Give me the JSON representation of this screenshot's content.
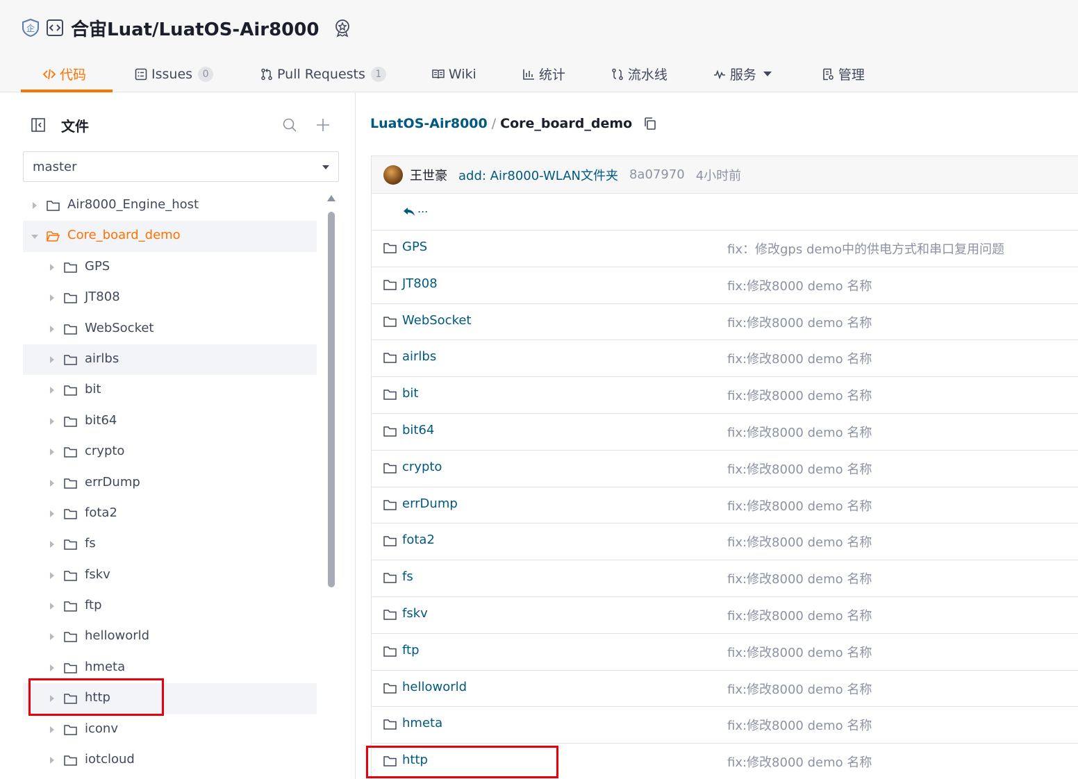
{
  "header": {
    "repo_title": "合宙Luat/LuatOS-Air8000",
    "tabs": [
      {
        "label": "代码",
        "active": true
      },
      {
        "label": "Issues",
        "count": "0"
      },
      {
        "label": "Pull Requests",
        "count": "1"
      },
      {
        "label": "Wiki"
      },
      {
        "label": "统计"
      },
      {
        "label": "流水线"
      },
      {
        "label": "服务"
      },
      {
        "label": "管理"
      }
    ]
  },
  "sidebar": {
    "title": "文件",
    "branch": "master",
    "tree": [
      {
        "label": "Air8000_Engine_host",
        "depth": 0
      },
      {
        "label": "Core_board_demo",
        "depth": 0,
        "expanded": true,
        "selected": true
      },
      {
        "label": "GPS",
        "depth": 1
      },
      {
        "label": "JT808",
        "depth": 1
      },
      {
        "label": "WebSocket",
        "depth": 1
      },
      {
        "label": "airlbs",
        "depth": 1,
        "highlighted": true
      },
      {
        "label": "bit",
        "depth": 1
      },
      {
        "label": "bit64",
        "depth": 1
      },
      {
        "label": "crypto",
        "depth": 1
      },
      {
        "label": "errDump",
        "depth": 1
      },
      {
        "label": "fota2",
        "depth": 1
      },
      {
        "label": "fs",
        "depth": 1
      },
      {
        "label": "fskv",
        "depth": 1
      },
      {
        "label": "ftp",
        "depth": 1
      },
      {
        "label": "helloworld",
        "depth": 1
      },
      {
        "label": "hmeta",
        "depth": 1
      },
      {
        "label": "http",
        "depth": 1,
        "highlighted": true
      },
      {
        "label": "iconv",
        "depth": 1
      },
      {
        "label": "iotcloud",
        "depth": 1
      }
    ]
  },
  "main": {
    "breadcrumb": {
      "root": "LuatOS-Air8000",
      "separator": "/",
      "current": "Core_board_demo"
    },
    "last_commit": {
      "author": "王世豪",
      "message": "add: Air8000-WLAN文件夹",
      "sha": "8a07970",
      "time": "4小时前"
    },
    "up_label": "...",
    "files": [
      {
        "name": "GPS",
        "commit": "fix：修改gps demo中的供电方式和串口复用问题"
      },
      {
        "name": "JT808",
        "commit": "fix:修改8000 demo 名称"
      },
      {
        "name": "WebSocket",
        "commit": "fix:修改8000 demo 名称"
      },
      {
        "name": "airlbs",
        "commit": "fix:修改8000 demo 名称"
      },
      {
        "name": "bit",
        "commit": "fix:修改8000 demo 名称"
      },
      {
        "name": "bit64",
        "commit": "fix:修改8000 demo 名称"
      },
      {
        "name": "crypto",
        "commit": "fix:修改8000 demo 名称"
      },
      {
        "name": "errDump",
        "commit": "fix:修改8000 demo 名称"
      },
      {
        "name": "fota2",
        "commit": "fix:修改8000 demo 名称"
      },
      {
        "name": "fs",
        "commit": "fix:修改8000 demo 名称"
      },
      {
        "name": "fskv",
        "commit": "fix:修改8000 demo 名称"
      },
      {
        "name": "ftp",
        "commit": "fix:修改8000 demo 名称"
      },
      {
        "name": "helloworld",
        "commit": "fix:修改8000 demo 名称"
      },
      {
        "name": "hmeta",
        "commit": "fix:修改8000 demo 名称"
      },
      {
        "name": "http",
        "commit": "fix:修改8000 demo 名称"
      }
    ]
  },
  "colors": {
    "accent": "#fe7300",
    "link": "#005980",
    "muted": "#8c92a4",
    "annotation": "#e8000b"
  }
}
